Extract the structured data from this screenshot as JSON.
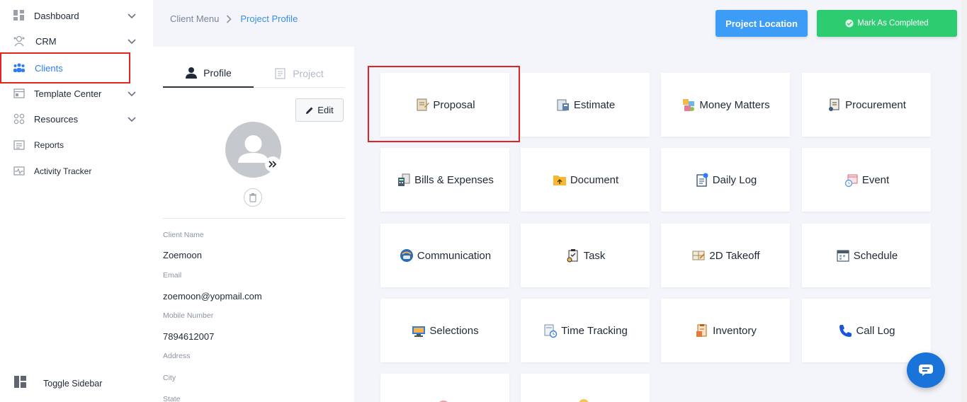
{
  "sidebar": {
    "items": [
      {
        "label": "Dashboard",
        "icon": "dashboard-icon",
        "has_chevron": true
      },
      {
        "label": "CRM",
        "icon": "crm-icon",
        "has_chevron": true
      },
      {
        "label": "Clients",
        "icon": "clients-icon",
        "has_chevron": false,
        "active": true
      },
      {
        "label": "Template Center",
        "icon": "template-icon",
        "has_chevron": true
      },
      {
        "label": "Resources",
        "icon": "resources-icon",
        "has_chevron": true
      },
      {
        "label": "Reports",
        "icon": "reports-icon",
        "has_chevron": false
      },
      {
        "label": "Activity Tracker",
        "icon": "activity-icon",
        "has_chevron": false
      }
    ],
    "toggle_label": "Toggle Sidebar"
  },
  "breadcrumb": {
    "parent": "Client Menu",
    "current": "Project Profile"
  },
  "header": {
    "project_location_label": "Project Location",
    "mark_completed_label": "Mark As Completed"
  },
  "profile": {
    "tabs": [
      "Profile",
      "Project"
    ],
    "edit_label": "Edit",
    "fields": [
      {
        "label": "Client Name",
        "value": "Zoemoon"
      },
      {
        "label": "Email",
        "value": "zoemoon@yopmail.com"
      },
      {
        "label": "Mobile Number",
        "value": "7894612007"
      },
      {
        "label": "Address",
        "value": ""
      },
      {
        "label": "City",
        "value": ""
      },
      {
        "label": "State",
        "value": ""
      }
    ]
  },
  "modules": [
    {
      "label": "Proposal",
      "icon": "proposal-icon"
    },
    {
      "label": "Estimate",
      "icon": "estimate-icon"
    },
    {
      "label": "Money Matters",
      "icon": "money-matters-icon"
    },
    {
      "label": "Procurement",
      "icon": "procurement-icon"
    },
    {
      "label": "Bills & Expenses",
      "icon": "bills-icon"
    },
    {
      "label": "Document",
      "icon": "document-icon"
    },
    {
      "label": "Daily Log",
      "icon": "daily-log-icon"
    },
    {
      "label": "Event",
      "icon": "event-icon"
    },
    {
      "label": "Communication",
      "icon": "communication-icon"
    },
    {
      "label": "Task",
      "icon": "task-icon"
    },
    {
      "label": "2D Takeoff",
      "icon": "takeoff-icon"
    },
    {
      "label": "Schedule",
      "icon": "schedule-icon"
    },
    {
      "label": "Selections",
      "icon": "selections-icon"
    },
    {
      "label": "Time Tracking",
      "icon": "time-tracking-icon"
    },
    {
      "label": "Inventory",
      "icon": "inventory-icon"
    },
    {
      "label": "Call Log",
      "icon": "call-log-icon"
    }
  ],
  "colors": {
    "accent": "#3d9cf5",
    "success": "#2ecc71",
    "highlight": "#e02424",
    "chat": "#1a73d8"
  }
}
